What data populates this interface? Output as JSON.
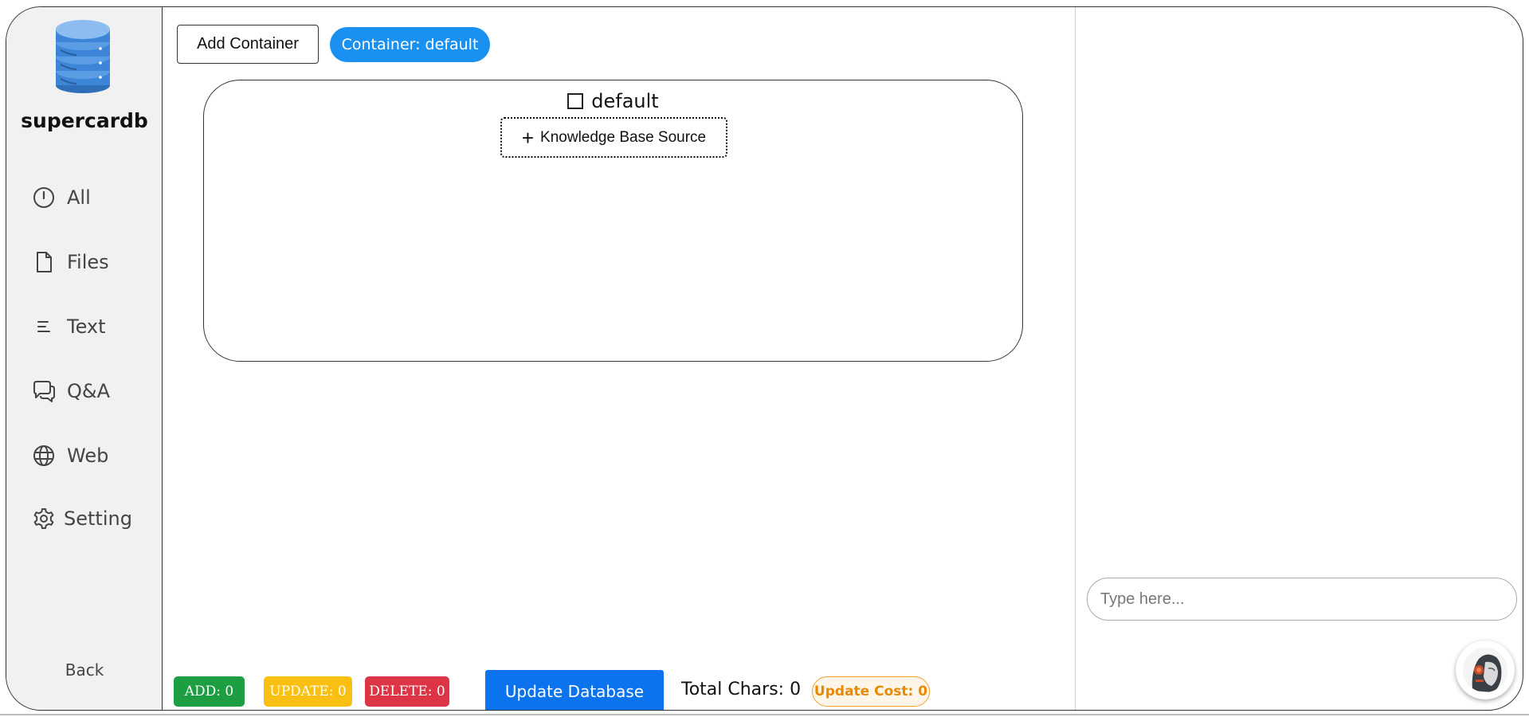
{
  "sidebar": {
    "brand": "supercardb",
    "items": [
      {
        "label": "All",
        "icon": "clock-icon"
      },
      {
        "label": "Files",
        "icon": "file-icon"
      },
      {
        "label": "Text",
        "icon": "text-lines-icon"
      },
      {
        "label": "Q&A",
        "icon": "chat-bubbles-icon"
      },
      {
        "label": "Web",
        "icon": "globe-icon"
      },
      {
        "label": "Setting",
        "icon": "gear-icon"
      }
    ],
    "back_label": "Back"
  },
  "toolbar": {
    "add_container_label": "Add Container",
    "container_pill_label": "Container: default"
  },
  "container": {
    "name": "default",
    "add_source_label": "Knowledge Base Source"
  },
  "footer": {
    "add_badge": "ADD: 0",
    "update_badge": "UPDATE: 0",
    "delete_badge": "DELETE: 0",
    "update_db_label": "Update Database",
    "total_chars": "Total Chars: 0",
    "update_cost": "Update Cost: 0"
  },
  "chat": {
    "input_placeholder": "Type here...",
    "input_value": ""
  },
  "colors": {
    "primary_blue": "#1a91f0",
    "button_blue": "#0b73ee",
    "add_green": "#1e9e43",
    "update_yellow": "#f9bf12",
    "delete_red": "#dc3545",
    "cost_orange": "#e88a00",
    "sidebar_bg": "#f1f1f1"
  }
}
